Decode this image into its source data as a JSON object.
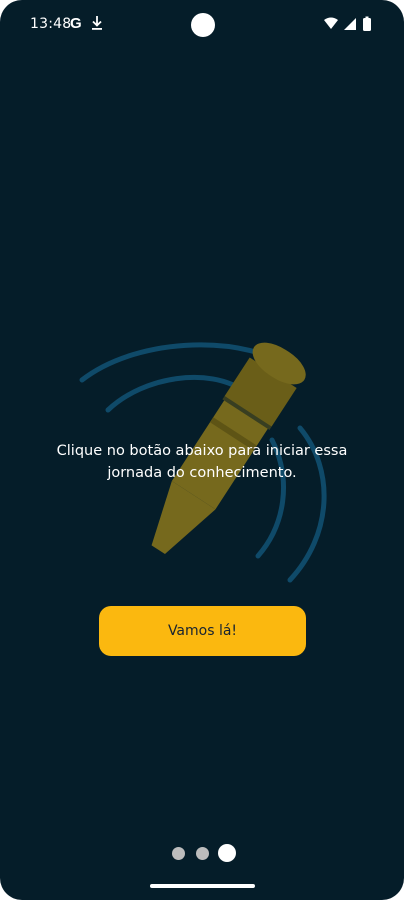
{
  "status_bar": {
    "time": "13:48",
    "google_letter": "G",
    "icons": [
      "google-icon",
      "download-icon",
      "wifi-icon",
      "cell-signal-icon",
      "battery-icon"
    ]
  },
  "onboarding": {
    "message": "Clique no botão abaixo para iniciar essa jornada do conhecimento.",
    "button_label": "Vamos lá!",
    "illustration_icon": "pen-icon",
    "page_indicator": {
      "total": 3,
      "current": 3
    }
  },
  "colors": {
    "background": "#051D29",
    "accent": "#FBB80F",
    "arc": "#0F4A69",
    "pen": "#76691D"
  }
}
